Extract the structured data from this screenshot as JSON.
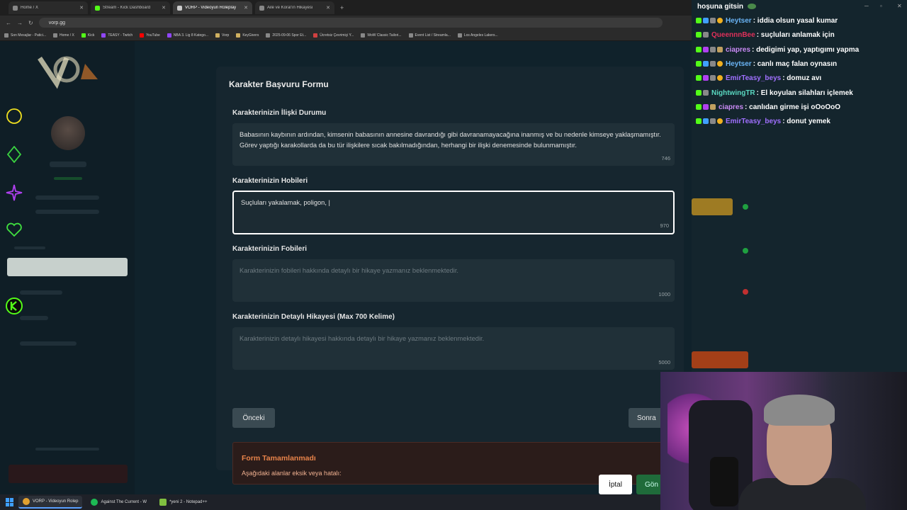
{
  "browser": {
    "tabs": [
      {
        "label": "Home / X",
        "active": false
      },
      {
        "label": "Stream - Kick Dashboard",
        "active": false
      },
      {
        "label": "VORP - Videoyun Roleplay",
        "active": true
      },
      {
        "label": "Aile ve Koral'ın Hikayesi",
        "active": false
      }
    ],
    "url": "vorp.gg",
    "bookmarks": [
      "Son Mesajlar - Patici...",
      "Home / X",
      "Kick",
      "TEASY - Twitch",
      "YouTube",
      "NBA 3. Lig 8 Katego...",
      "Vorp",
      "KeyGivers",
      "2025-09-06 Spor Et...",
      "Ücretsiz Çevrimiçi Y...",
      "WoW Classic Tailori...",
      "Event List / Streamla...",
      "Los Angeles Lakers..."
    ]
  },
  "modal": {
    "title": "Karakter Başvuru Formu",
    "fields": [
      {
        "label": "Karakterinizin İlişki Durumu",
        "value": "Babasının kaybının ardından, kimsenin babasının annesine davrandığı gibi davranamayacağına inanmış ve bu nedenle kimseye yaklaşmamıştır. Görev yaptığı karakollarda da bu tür ilişkilere sıcak bakılmadığından, herhangi bir ilişki denemesinde bulunmamıştır.",
        "placeholder": "",
        "counter": "746"
      },
      {
        "label": "Karakterinizin Hobileri",
        "value": "Suçluları yakalamak, poligon, |",
        "placeholder": "",
        "counter": "970"
      },
      {
        "label": "Karakterinizin Fobileri",
        "value": "",
        "placeholder": "Karakterinizin fobileri hakkında detaylı bir hikaye yazmanız beklenmektedir.",
        "counter": "1000"
      },
      {
        "label": "Karakterinizin Detaylı Hikayesi (Max 700 Kelime)",
        "value": "",
        "placeholder": "Karakterinizin detaylı hikayesi hakkında detaylı bir hikaye yazmanız beklenmektedir.",
        "counter": "5000"
      }
    ],
    "prev_label": "Önceki",
    "next_label": "Sonra",
    "error_title": "Form Tamamlanmadı",
    "error_text": "Aşağıdaki alanlar eksik veya hatalı:"
  },
  "footer": {
    "cancel_label": "İptal",
    "submit_label": "Gön"
  },
  "chat": {
    "top_text": "hoşuna gitsin",
    "messages": [
      {
        "user": "Heytser",
        "color": "#6ab4f5",
        "text": ": iddia olsun yasal kumar"
      },
      {
        "user": "QueennnBee",
        "color": "#e0305a",
        "text": ": suçluları anlamak için"
      },
      {
        "user": "ciapres",
        "color": "#c98af5",
        "text": ": dedigimi yap, yaptıgımı yapma"
      },
      {
        "user": "Heytser",
        "color": "#6ab4f5",
        "text": ": canlı maç falan oynasın"
      },
      {
        "user": "EmirTeasy_beys",
        "color": "#a070ff",
        "text": ": domuz avı"
      },
      {
        "user": "NightwingTR",
        "color": "#5ad8c0",
        "text": ": El koyulan silahları içlemek"
      },
      {
        "user": "ciapres",
        "color": "#c98af5",
        "text": ": canlıdan girme işi oOoOoO"
      },
      {
        "user": "EmirTeasy_beys",
        "color": "#a070ff",
        "text": ": donut yemek"
      }
    ]
  },
  "taskbar": {
    "items": [
      {
        "label": "VORP - Videoyun Rolep",
        "active": true
      },
      {
        "label": "Against The Current - W",
        "active": false
      },
      {
        "label": "*yeni 2 - Notepad++",
        "active": false
      }
    ]
  }
}
